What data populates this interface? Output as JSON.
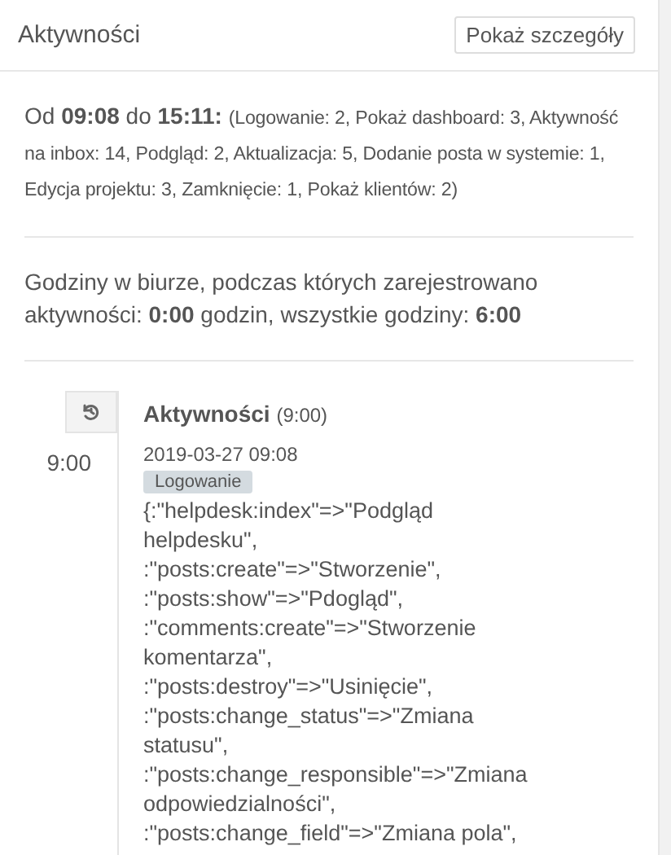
{
  "panel": {
    "title": "Aktywności",
    "details_button": "Pokaż szczegóły"
  },
  "summary": {
    "range": "Od **09:08** do **15:11:**",
    "details": "(Logowanie: 2, Pokaż dashboard: 3, Aktywność na inbox: 14, Podgląd: 2, Aktualizacja: 5, Dodanie posta w systemie: 1, Edycja projektu: 3, Zamknięcie: 1, Pokaż klientów: 2)"
  },
  "office_hours": "Godziny w biurze, podczas których zarejestrowano aktywności: **0:00** godzin, wszystkie godziny: **6:00**",
  "timeline": [
    {
      "time": "9:00",
      "title": "Aktywności",
      "title_time": "(9:00)",
      "entries": [
        {
          "timestamp": "2019-03-27 09:08",
          "tag": "Logowanie",
          "content": "{:\"helpdesk:index\"=>\"Podgląd helpdesku\", :\"posts:create\"=>\"Stworzenie\", :\"posts:show\"=>\"Pdogląd\", :\"comments:create\"=>\"Stworzenie komentarza\", :\"posts:destroy\"=>\"Usinięcie\", :\"posts:change_status\"=>\"Zmiana statusu\", :\"posts:change_responsible\"=>\"Zmiana odpowiedzialności\", :\"posts:change_field\"=>\"Zmiana pola\","
        }
      ]
    }
  ]
}
